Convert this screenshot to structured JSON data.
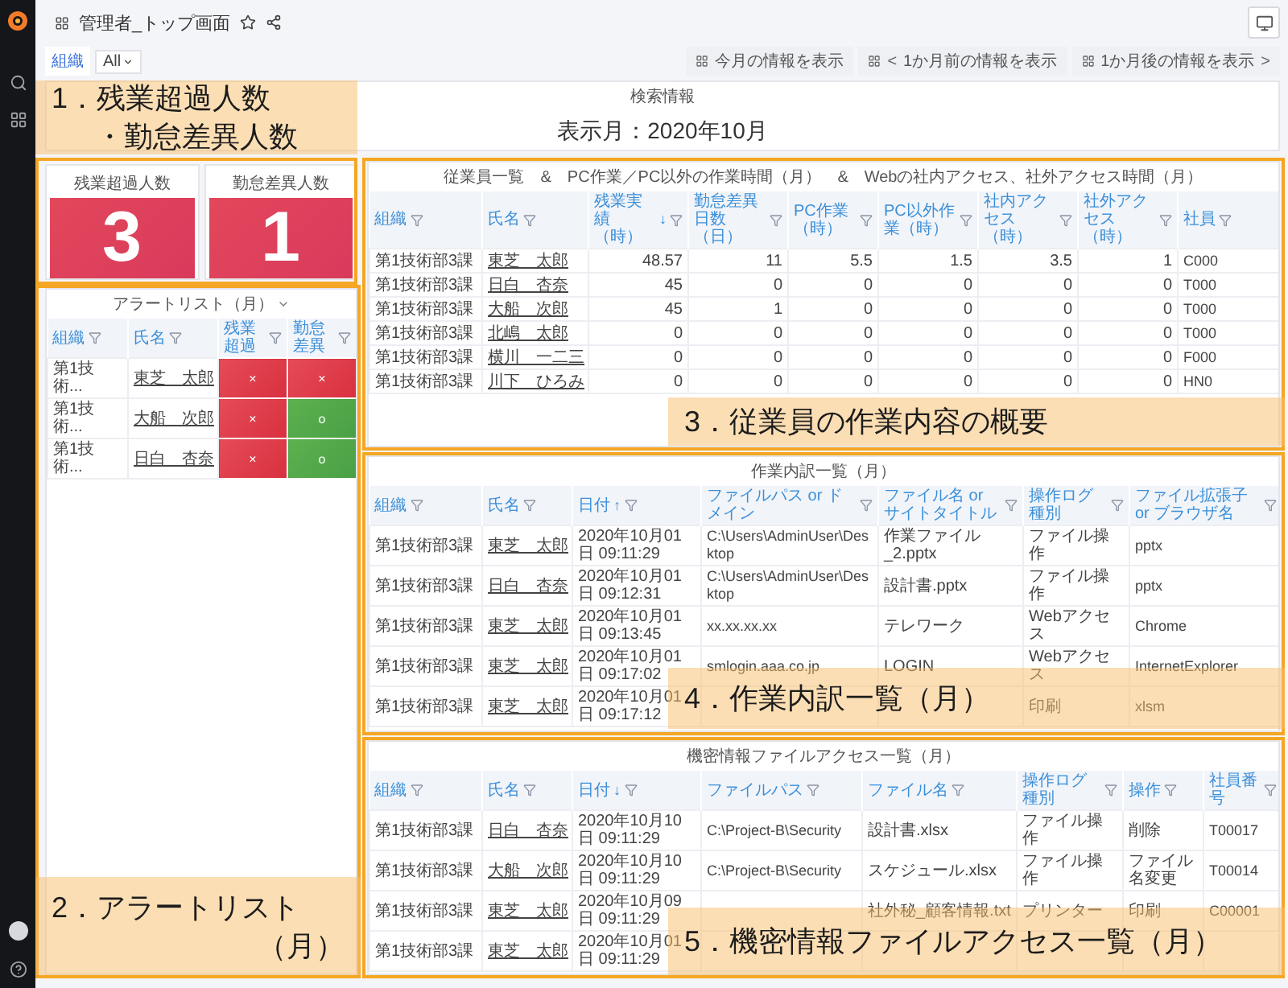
{
  "header": {
    "title": "管理者_トップ画面"
  },
  "variables": [
    {
      "label": "組織",
      "value": "All"
    }
  ],
  "nav_buttons": [
    {
      "label": "今月の情報を表示",
      "kind": "plain"
    },
    {
      "label": "1か月前の情報を表示",
      "kind": "prev",
      "arrow": "<"
    },
    {
      "label": "1か月後の情報を表示",
      "kind": "next",
      "arrow": ">"
    }
  ],
  "search_panel": {
    "title": "検索情報",
    "display": "表示月：2020年10月"
  },
  "stats": [
    {
      "title": "残業超過人数",
      "value": "3"
    },
    {
      "title": "勤怠差異人数",
      "value": "1"
    }
  ],
  "alert_list": {
    "title": "アラートリスト（月）",
    "columns": [
      {
        "label": "組織",
        "kind": "text"
      },
      {
        "label": "氏名",
        "kind": "link"
      },
      {
        "label": "残業超過",
        "kind": "flag"
      },
      {
        "label": "勤怠差異",
        "kind": "flag"
      }
    ],
    "rows": [
      {
        "cells": [
          "第1技術...",
          "東芝　太郎",
          {
            "text": "×",
            "alert": true
          },
          {
            "text": "×",
            "alert": true
          }
        ]
      },
      {
        "cells": [
          "第1技術...",
          "大船　次郎",
          {
            "text": "×",
            "alert": true
          },
          {
            "text": "o",
            "alert": false
          }
        ]
      },
      {
        "cells": [
          "第1技術...",
          "日白　杏奈",
          {
            "text": "×",
            "alert": true
          },
          {
            "text": "o",
            "alert": false
          }
        ]
      }
    ]
  },
  "employee_table": {
    "title": "従業員一覧　&　PC作業／PC以外の作業時間（月）　&　Webの社内アクセス、社外アクセス時間（月）",
    "columns": [
      {
        "label": "組織",
        "kind": "text"
      },
      {
        "label": "氏名",
        "kind": "link"
      },
      {
        "label": "残業実績（時）",
        "kind": "number",
        "sort": "↓"
      },
      {
        "label": "勤怠差異日数（日）",
        "kind": "number"
      },
      {
        "label": "PC作業（時）",
        "kind": "number"
      },
      {
        "label": "PC以外作業（時）",
        "kind": "number"
      },
      {
        "label": "社内アクセス（時）",
        "kind": "number"
      },
      {
        "label": "社外アクセス（時）",
        "kind": "number"
      },
      {
        "label": "社員",
        "kind": "code"
      }
    ],
    "rows": [
      {
        "cells": [
          "第1技術部3課",
          "東芝　太郎",
          "48.57",
          "11",
          "5.5",
          "1.5",
          "3.5",
          "1",
          "C000"
        ]
      },
      {
        "cells": [
          "第1技術部3課",
          "日白　杏奈",
          "45",
          "0",
          "0",
          "0",
          "0",
          "0",
          "T000"
        ]
      },
      {
        "cells": [
          "第1技術部3課",
          "大船　次郎",
          "45",
          "1",
          "0",
          "0",
          "0",
          "0",
          "T000"
        ]
      },
      {
        "cells": [
          "第1技術部3課",
          "北嶋　太郎",
          "0",
          "0",
          "0",
          "0",
          "0",
          "0",
          "T000"
        ]
      },
      {
        "cells": [
          "第1技術部3課",
          "横川　一二三",
          "0",
          "0",
          "0",
          "0",
          "0",
          "0",
          "F000"
        ]
      },
      {
        "cells": [
          "第1技術部3課",
          "川下　ひろみ",
          "0",
          "0",
          "0",
          "0",
          "0",
          "0",
          "HN0"
        ]
      }
    ]
  },
  "work_table": {
    "title": "作業内訳一覧（月）",
    "columns": [
      {
        "label": "組織",
        "kind": "text"
      },
      {
        "label": "氏名",
        "kind": "link"
      },
      {
        "label": "日付",
        "kind": "text",
        "sort": "↑"
      },
      {
        "label": "ファイルパス or ドメイン",
        "kind": "code"
      },
      {
        "label": "ファイル名 or サイトタイトル",
        "kind": "text"
      },
      {
        "label": "操作ログ種別",
        "kind": "text"
      },
      {
        "label": "ファイル拡張子 or ブラウザ名",
        "kind": "code"
      }
    ],
    "rows": [
      {
        "cells": [
          "第1技術部3課",
          "東芝　太郎",
          "2020年10月01日 09:11:29",
          "C:\\Users\\AdminUser\\Desktop",
          "作業ファイル_2.pptx",
          "ファイル操作",
          "pptx"
        ]
      },
      {
        "cells": [
          "第1技術部3課",
          "日白　杏奈",
          "2020年10月01日 09:12:31",
          "C:\\Users\\AdminUser\\Desktop",
          "設計書.pptx",
          "ファイル操作",
          "pptx"
        ]
      },
      {
        "cells": [
          "第1技術部3課",
          "東芝　太郎",
          "2020年10月01日 09:13:45",
          "xx.xx.xx.xx",
          "テレワーク",
          "Webアクセス",
          "Chrome"
        ]
      },
      {
        "cells": [
          "第1技術部3課",
          "東芝　太郎",
          "2020年10月01日 09:17:02",
          "smlogin.aaa.co.jp",
          "LOGIN",
          "Webアクセス",
          "InternetExplorer"
        ]
      },
      {
        "cells": [
          "第1技術部3課",
          "東芝　太郎",
          "2020年10月01日 09:17:12",
          null,
          null,
          "印刷",
          "xlsm"
        ]
      }
    ]
  },
  "secret_table": {
    "title": "機密情報ファイルアクセス一覧（月）",
    "columns": [
      {
        "label": "組織",
        "kind": "text"
      },
      {
        "label": "氏名",
        "kind": "link"
      },
      {
        "label": "日付",
        "kind": "text",
        "sort": "↓"
      },
      {
        "label": "ファイルパス",
        "kind": "code"
      },
      {
        "label": "ファイル名",
        "kind": "text"
      },
      {
        "label": "操作ログ種別",
        "kind": "text"
      },
      {
        "label": "操作",
        "kind": "text"
      },
      {
        "label": "社員番号",
        "kind": "code"
      }
    ],
    "rows": [
      {
        "cells": [
          "第1技術部3課",
          "日白　杏奈",
          "2020年10月10日 09:11:29",
          "C:\\Project-B\\Security",
          "設計書.xlsx",
          "ファイル操作",
          "削除",
          "T00017"
        ]
      },
      {
        "cells": [
          "第1技術部3課",
          "大船　次郎",
          "2020年10月10日 09:11:29",
          "C:\\Project-B\\Security",
          "スケジュール.xlsx",
          "ファイル操作",
          "ファイル名変更",
          "T00014"
        ]
      },
      {
        "cells": [
          "第1技術部3課",
          "東芝　太郎",
          "2020年10月09日 09:11:29",
          null,
          "社外秘_顧客情報.txt",
          "プリンター",
          "印刷",
          "C00001"
        ]
      },
      {
        "cells": [
          "第1技術部3課",
          "東芝　太郎",
          "2020年10月01日 09:11:29",
          null,
          null,
          null,
          null,
          null
        ]
      }
    ]
  },
  "callouts": [
    {
      "lines": [
        "1．残業超過人数",
        "・勤怠差異人数"
      ]
    },
    {
      "lines": [
        "2．アラートリスト",
        "（月）"
      ]
    },
    {
      "lines": [
        "3．従業員の作業内容の概要"
      ]
    },
    {
      "lines": [
        "4．作業内訳一覧（月）"
      ]
    },
    {
      "lines": [
        "5．機密情報ファイルアクセス一覧（月）"
      ]
    }
  ]
}
